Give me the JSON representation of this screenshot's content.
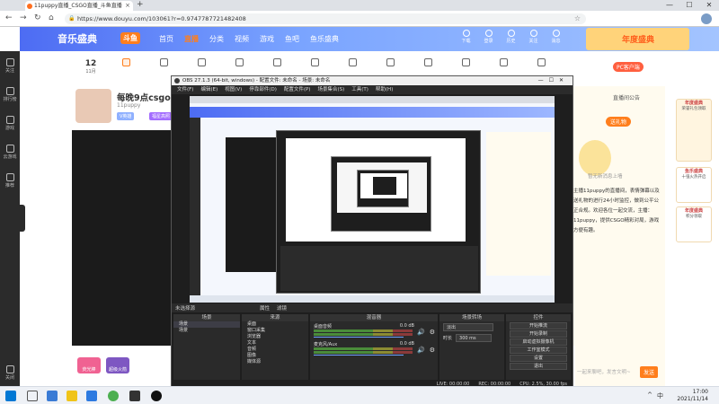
{
  "browser": {
    "tab_title": "11puppy直播_CSGO直播_斗鱼直播",
    "new_tab": "+",
    "url": "https://www.douyu.com/103061?r=0.9747787721482408",
    "window_controls": [
      "—",
      "☐",
      "✕"
    ]
  },
  "site": {
    "logo": "音乐盛典",
    "logo_badge": "斗鱼",
    "nav": [
      "首页",
      "直播",
      "分类",
      "视频",
      "游戏",
      "鱼吧",
      "鱼乐盛典"
    ],
    "active_nav": "直播",
    "header_icons": [
      "下载",
      "登录",
      "历史",
      "关注",
      "消息"
    ],
    "banner_text": "年度盛典",
    "pc_badge": "PC客户端",
    "date_day": "12",
    "date_month": "11月"
  },
  "left_sidebar": [
    {
      "label": "关注"
    },
    {
      "label": "排行榜"
    },
    {
      "label": "游戏"
    },
    {
      "label": "云游戏"
    },
    {
      "label": "推荐"
    },
    {
      "label": "关闭"
    }
  ],
  "streamer": {
    "title": "每晚9点csgo启动",
    "name": "11puppy",
    "badge": "V英雄",
    "badge2": "福星高照"
  },
  "right_panel": {
    "header": "直播间公告",
    "button": "送礼物",
    "caption": "暂无新消息上墙",
    "text": "主播11puppy的直播间，表情弹幕以及送礼物的进行24小时监控，做到公平公正合规。欢迎各位一起交流，主播：11puppy，提供CSGO精彩对局，游戏方便有趣。",
    "input_placeholder": "一起来聊吧，发言文明~",
    "send_label": "发送"
  },
  "ads": [
    {
      "title": "年度盛典",
      "sub": "荣誉礼包领取"
    },
    {
      "title": "鱼乐盛典",
      "sub": "十强火热开启"
    },
    {
      "title": "年度盛典",
      "sub": "积分领取"
    }
  ],
  "gifts": [
    "荧光棒",
    "超级火箭"
  ],
  "obs": {
    "title": "OBS 27.1.3 (64-bit, windows) - 配置文件: 未命名 - 场景: 未命名",
    "menu": [
      "文件(F)",
      "编辑(E)",
      "视图(V)",
      "停靠部件(D)",
      "配置文件(P)",
      "场景集合(S)",
      "工具(T)",
      "帮助(H)"
    ],
    "dock_label": "未选择源",
    "dock_tabs": [
      "属性",
      "滤镜"
    ],
    "scenes_header": "场景",
    "scenes": [
      "场景",
      "场景"
    ],
    "sources_header": "来源",
    "sources": [
      "桌面",
      "窗口采集",
      "浏览器",
      "文本",
      "音频",
      "图像",
      "媒体源"
    ],
    "mixer_header": "混音器",
    "mixer": [
      {
        "name": "桌面音频",
        "db": "0.0 dB"
      },
      {
        "name": "麦克风/Aux",
        "db": "0.0 dB"
      }
    ],
    "transitions_header": "场景转场",
    "transition_value": "淡出",
    "duration_label": "时长",
    "duration_value": "300 ms",
    "controls_header": "控件",
    "controls": [
      "开始推流",
      "开始录制",
      "启动虚拟摄像机",
      "工作室模式",
      "设置",
      "退出"
    ],
    "status": [
      "LIVE: 00:00:00",
      "REC: 00:00:00",
      "CPU: 2.5%, 30.00 fps"
    ]
  },
  "taskbar": {
    "time": "17:00",
    "date": "2021/11/14",
    "tray": [
      "^",
      "中"
    ]
  }
}
